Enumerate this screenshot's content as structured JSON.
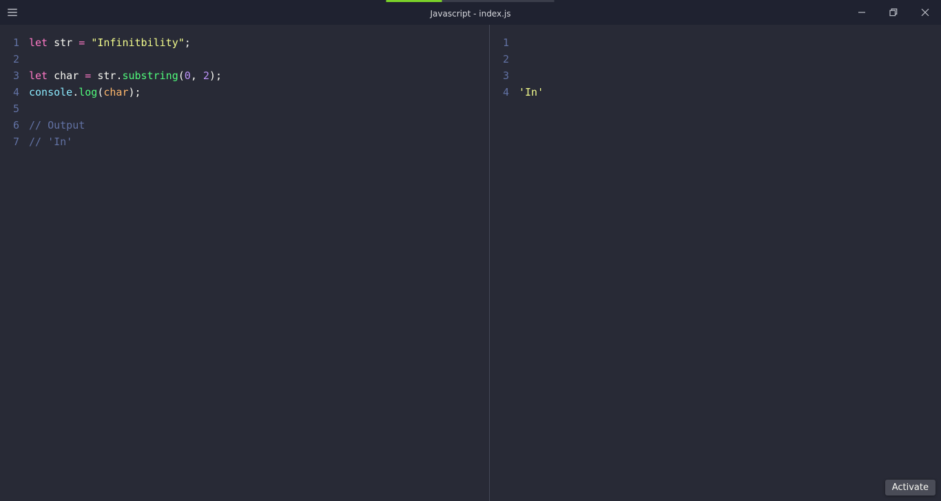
{
  "window": {
    "title": "Javascript - index.js"
  },
  "editor": {
    "left": {
      "lines": [
        {
          "n": 1,
          "tokens": [
            {
              "cls": "t-keyword",
              "text": "let"
            },
            {
              "cls": "t-plain",
              "text": " "
            },
            {
              "cls": "t-plain",
              "text": "str"
            },
            {
              "cls": "t-plain",
              "text": " "
            },
            {
              "cls": "t-op",
              "text": "="
            },
            {
              "cls": "t-plain",
              "text": " "
            },
            {
              "cls": "t-string",
              "text": "\"Infinitbility\""
            },
            {
              "cls": "t-punct",
              "text": ";"
            }
          ]
        },
        {
          "n": 2,
          "tokens": []
        },
        {
          "n": 3,
          "tokens": [
            {
              "cls": "t-keyword",
              "text": "let"
            },
            {
              "cls": "t-plain",
              "text": " "
            },
            {
              "cls": "t-plain",
              "text": "char"
            },
            {
              "cls": "t-plain",
              "text": " "
            },
            {
              "cls": "t-op",
              "text": "="
            },
            {
              "cls": "t-plain",
              "text": " "
            },
            {
              "cls": "t-plain",
              "text": "str"
            },
            {
              "cls": "t-punct",
              "text": "."
            },
            {
              "cls": "t-func",
              "text": "substring"
            },
            {
              "cls": "t-punct",
              "text": "("
            },
            {
              "cls": "t-number",
              "text": "0"
            },
            {
              "cls": "t-punct",
              "text": ","
            },
            {
              "cls": "t-plain",
              "text": " "
            },
            {
              "cls": "t-number",
              "text": "2"
            },
            {
              "cls": "t-punct",
              "text": ")"
            },
            {
              "cls": "t-punct",
              "text": ";"
            }
          ]
        },
        {
          "n": 4,
          "tokens": [
            {
              "cls": "t-object",
              "text": "console"
            },
            {
              "cls": "t-punct",
              "text": "."
            },
            {
              "cls": "t-func",
              "text": "log"
            },
            {
              "cls": "t-punct",
              "text": "("
            },
            {
              "cls": "t-param",
              "text": "char"
            },
            {
              "cls": "t-punct",
              "text": ")"
            },
            {
              "cls": "t-punct",
              "text": ";"
            }
          ]
        },
        {
          "n": 5,
          "tokens": []
        },
        {
          "n": 6,
          "tokens": [
            {
              "cls": "t-comment",
              "text": "// Output"
            }
          ]
        },
        {
          "n": 7,
          "tokens": [
            {
              "cls": "t-comment",
              "text": "// 'In'"
            }
          ]
        }
      ]
    },
    "right": {
      "lines": [
        {
          "n": 1,
          "tokens": []
        },
        {
          "n": 2,
          "tokens": []
        },
        {
          "n": 3,
          "tokens": []
        },
        {
          "n": 4,
          "tokens": [
            {
              "cls": "t-string",
              "text": "'In'"
            }
          ]
        }
      ]
    }
  },
  "activate": {
    "label": "Activate"
  },
  "colors": {
    "bg": "#282a36",
    "titlebar": "#1f2230",
    "accent": "#7bd12a"
  }
}
